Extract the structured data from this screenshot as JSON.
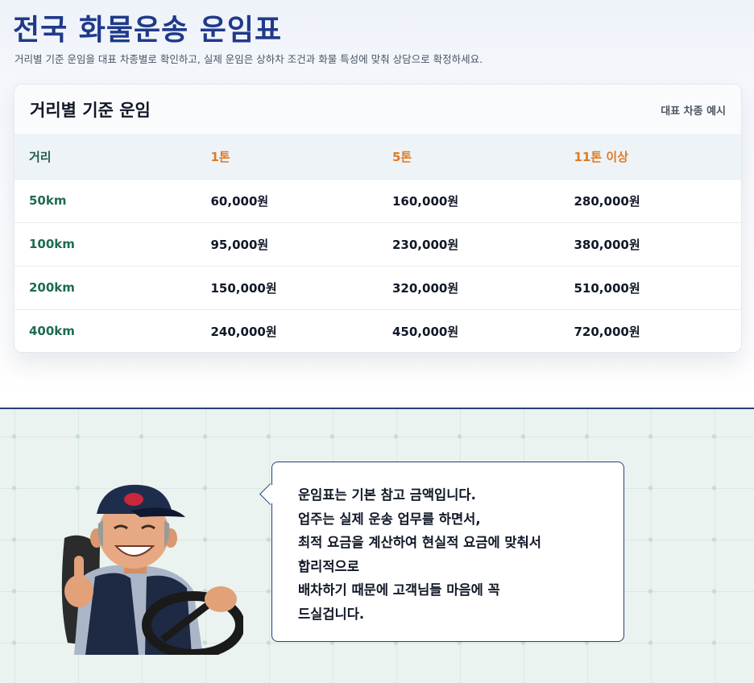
{
  "header": {
    "title": "전국 화물운송 운임표",
    "subtitle": "거리별 기준 운임을 대표 차종별로 확인하고, 실제 운임은 상하차 조건과 화물 특성에 맞춰 상담으로 확정하세요."
  },
  "card": {
    "title": "거리별 기준 운임",
    "note": "대표 차종 예시",
    "columns": [
      "거리",
      "1톤",
      "5톤",
      "11톤 이상"
    ],
    "rows": [
      {
        "distance": "50km",
        "ton1": "60,000원",
        "ton5": "160,000원",
        "ton11": "280,000원"
      },
      {
        "distance": "100km",
        "ton1": "95,000원",
        "ton5": "230,000원",
        "ton11": "380,000원"
      },
      {
        "distance": "200km",
        "ton1": "150,000원",
        "ton5": "320,000원",
        "ton11": "510,000원"
      },
      {
        "distance": "400km",
        "ton1": "240,000원",
        "ton5": "450,000원",
        "ton11": "720,000원"
      }
    ]
  },
  "bubble": {
    "lines": [
      "운임표는 기본 참고 금액입니다.",
      "업주는 실제 운송 업무를 하면서,",
      "최적 요금을 계산하여 현실적 요금에 맞춰서",
      "합리적으로",
      "배차하기 때문에 고객님들 마음에 꼭",
      "드실겁니다."
    ]
  },
  "colors": {
    "title": "#1f3a8a",
    "distance": "#1f6b4f",
    "ton_header": "#e07a22",
    "divider": "#2b3f7a"
  }
}
